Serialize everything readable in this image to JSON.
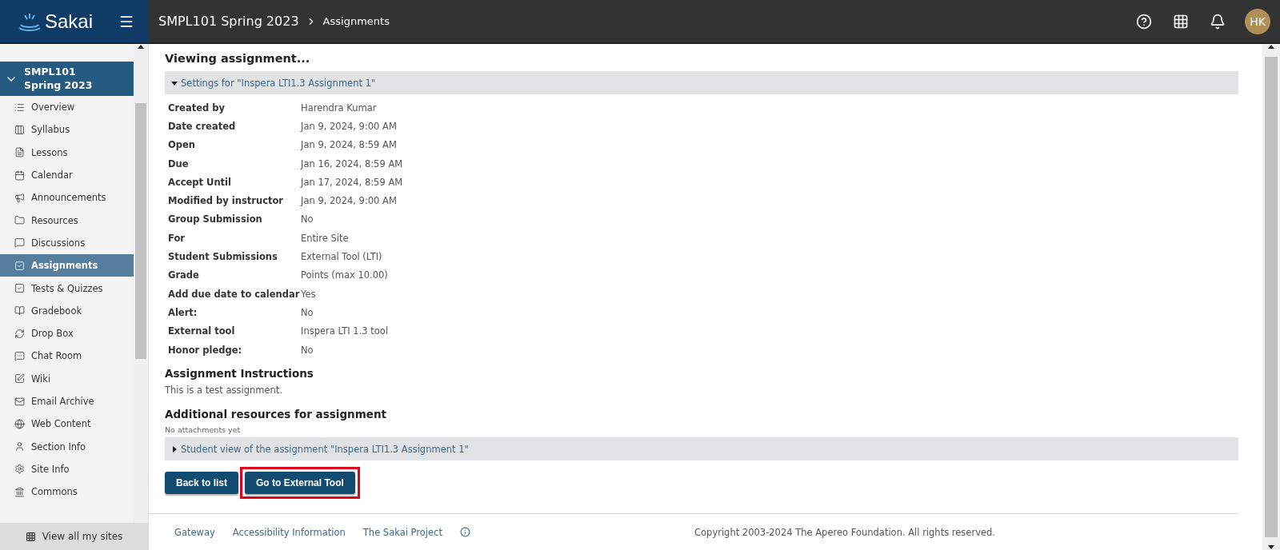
{
  "header": {
    "logo": "Sakai",
    "breadcrumb": [
      {
        "label": "SMPL101 Spring 2023"
      },
      {
        "label": "Assignments"
      }
    ],
    "avatar": "HK"
  },
  "sidebar": {
    "site": {
      "title": "SMPL101 Spring 2023",
      "expanded": true
    },
    "items": [
      {
        "label": "Overview",
        "selected": false
      },
      {
        "label": "Syllabus",
        "selected": false
      },
      {
        "label": "Lessons",
        "selected": false
      },
      {
        "label": "Calendar",
        "selected": false
      },
      {
        "label": "Announcements",
        "selected": false
      },
      {
        "label": "Resources",
        "selected": false
      },
      {
        "label": "Discussions",
        "selected": false
      },
      {
        "label": "Assignments",
        "selected": true
      },
      {
        "label": "Tests & Quizzes",
        "selected": false
      },
      {
        "label": "Gradebook",
        "selected": false
      },
      {
        "label": "Drop Box",
        "selected": false
      },
      {
        "label": "Chat Room",
        "selected": false
      },
      {
        "label": "Wiki",
        "selected": false
      },
      {
        "label": "Email Archive",
        "selected": false
      },
      {
        "label": "Web Content",
        "selected": false
      },
      {
        "label": "Section Info",
        "selected": false
      },
      {
        "label": "Site Info",
        "selected": false
      },
      {
        "label": "Commons",
        "selected": false
      }
    ],
    "view_all": "View all my sites"
  },
  "main": {
    "title": "Viewing assignment...",
    "settings": {
      "label": "Settings for \"Inspera LTI1.3 Assignment 1\"",
      "expanded": true,
      "rows": [
        {
          "label": "Created by",
          "value": "Harendra Kumar"
        },
        {
          "label": "Date created",
          "value": "Jan 9, 2024, 9:00 AM"
        },
        {
          "label": "Open",
          "value": "Jan 9, 2024, 8:59 AM"
        },
        {
          "label": "Due",
          "value": "Jan 16, 2024, 8:59 AM"
        },
        {
          "label": "Accept Until",
          "value": "Jan 17, 2024, 8:59 AM"
        },
        {
          "label": "Modified by instructor",
          "value": "Jan 9, 2024, 9:00 AM"
        },
        {
          "label": "Group Submission",
          "value": "No"
        },
        {
          "label": "For",
          "value": "Entire Site"
        },
        {
          "label": "Student Submissions",
          "value": "External Tool (LTI)"
        },
        {
          "label": "Grade",
          "value": "Points (max 10.00)"
        },
        {
          "label": "Add due date to calendar",
          "value": "Yes"
        },
        {
          "label": "Alert:",
          "value": "No"
        },
        {
          "label": "External tool",
          "value": "Inspera LTI 1.3 tool"
        },
        {
          "label": "Honor pledge:",
          "value": "No"
        }
      ]
    },
    "instructions_heading": "Assignment Instructions",
    "instructions": "This is a test assignment.",
    "resources_heading": "Additional resources for assignment",
    "resources_note": "No attachments yet",
    "student_view": {
      "label": "Student view of the assignment \"Inspera LTI1.3 Assignment 1\"",
      "expanded": false
    },
    "buttons": [
      {
        "label": "Back to list",
        "highlighted": false
      },
      {
        "label": "Go to External Tool",
        "highlighted": true
      }
    ]
  },
  "footer": {
    "links": [
      "Gateway",
      "Accessibility Information",
      "The Sakai Project"
    ],
    "copyright": "Copyright 2003-2024 The Apereo Foundation. All rights reserved."
  }
}
